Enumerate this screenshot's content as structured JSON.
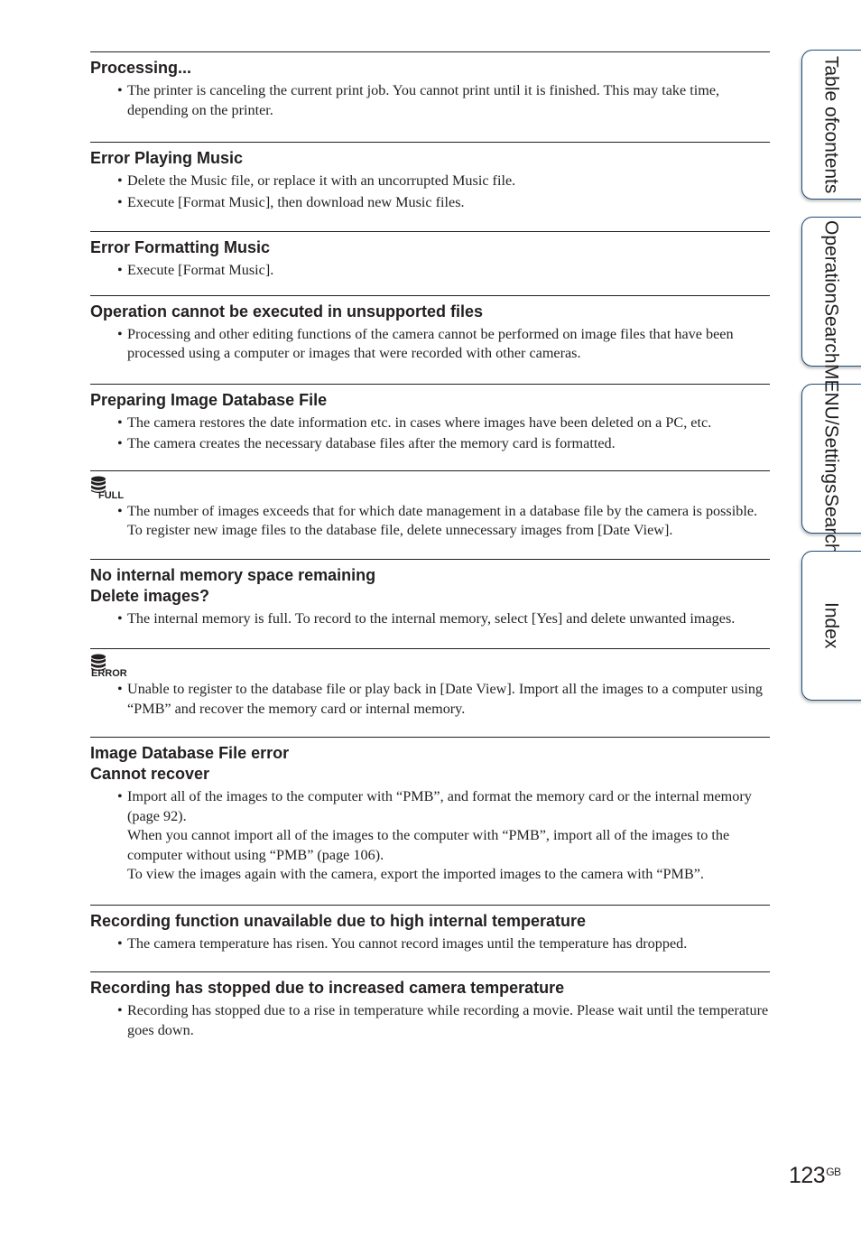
{
  "sections": [
    {
      "heading": [
        "Processing..."
      ],
      "bullets": [
        [
          "The printer is canceling the current print job. You cannot print until it is finished. This may take time, depending on the printer."
        ]
      ]
    },
    {
      "heading": [
        "Error Playing Music"
      ],
      "bullets": [
        [
          "Delete the Music file, or replace it with an uncorrupted Music file."
        ],
        [
          "Execute [Format Music], then download new Music files."
        ]
      ]
    },
    {
      "heading": [
        "Error Formatting Music"
      ],
      "bullets": [
        [
          "Execute [Format Music]."
        ]
      ]
    },
    {
      "heading": [
        "Operation cannot be executed in unsupported files"
      ],
      "bullets": [
        [
          "Processing and other editing functions of the camera cannot be performed on image files that have been processed using a computer or images that were recorded with other cameras."
        ]
      ]
    },
    {
      "heading": [
        "Preparing Image Database File"
      ],
      "bullets": [
        [
          "The camera restores the date information etc. in cases where images have been deleted on a PC, etc."
        ],
        [
          "The camera creates the necessary database files after the memory card is formatted."
        ]
      ]
    },
    {
      "icon": "database-full-icon",
      "icon_text": "FULL",
      "bullets": [
        [
          "The number of images exceeds that for which date management in a database file by the camera is possible. To register new image files to the database file, delete unnecessary images from [Date View]."
        ]
      ]
    },
    {
      "heading": [
        "No internal memory space remaining",
        "Delete images?"
      ],
      "bullets": [
        [
          "The internal memory is full. To record to the internal memory, select [Yes] and delete unwanted images."
        ]
      ]
    },
    {
      "icon": "database-error-icon",
      "icon_text": "ERROR",
      "bullets": [
        [
          "Unable to register to the database file or play back in [Date View]. Import all the images to a computer using “PMB” and recover the memory card or internal memory."
        ]
      ]
    },
    {
      "heading": [
        "Image Database File error",
        "Cannot recover"
      ],
      "bullets": [
        [
          "Import all of the images to the computer with “PMB”, and format the memory card or the internal memory (page 92).",
          "When you cannot import all of the images to the computer with “PMB”, import all of the images to the computer without using “PMB” (page 106).",
          "To view the images again with the camera, export the imported images to the camera with “PMB”."
        ]
      ]
    },
    {
      "heading": [
        "Recording function unavailable due to high internal temperature"
      ],
      "bullets": [
        [
          "The camera temperature has risen. You cannot record images until the temperature has dropped."
        ]
      ]
    },
    {
      "heading": [
        "Recording has stopped due to increased camera temperature"
      ],
      "bullets": [
        [
          "Recording has stopped due to a rise in temperature while recording a movie. Please wait until the temperature goes down."
        ]
      ]
    }
  ],
  "side_tabs": [
    {
      "lines": [
        "Table of",
        "contents"
      ]
    },
    {
      "lines": [
        "Operation",
        "Search"
      ]
    },
    {
      "lines": [
        "MENU/Settings",
        "Search"
      ]
    },
    {
      "lines": [
        "Index"
      ]
    }
  ],
  "page": {
    "number": "123",
    "suffix": "GB"
  },
  "colors": {
    "tab_border": "#1f4e79",
    "text": "#231f20"
  }
}
